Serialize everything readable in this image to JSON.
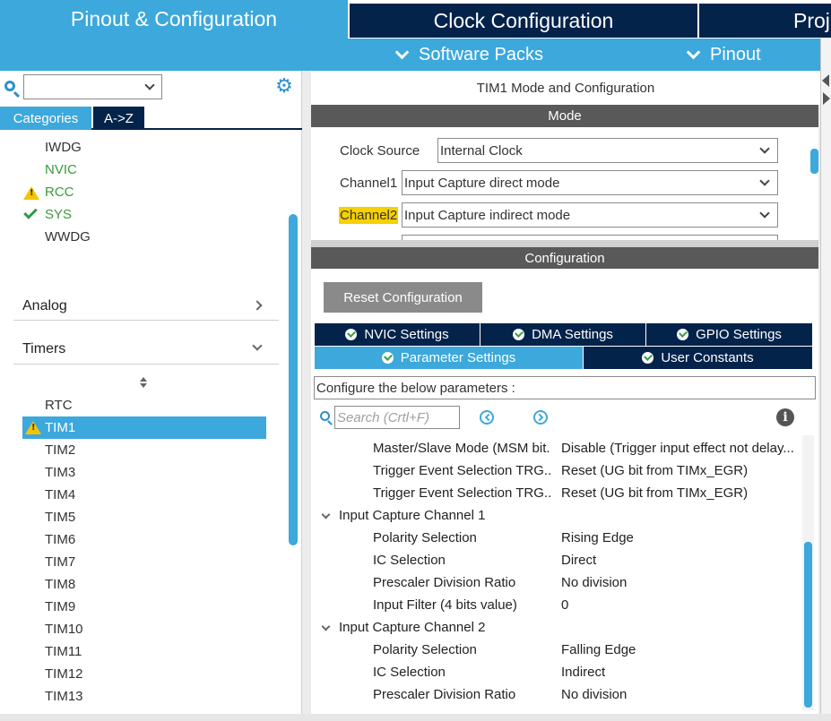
{
  "top_tabs": [
    "Pinout & Configuration",
    "Clock Configuration",
    "Proj"
  ],
  "subbar": {
    "software_packs": "Software Packs",
    "pinout": "Pinout"
  },
  "left": {
    "search_value": "",
    "cat_tabs": [
      "Categories",
      "A->Z"
    ],
    "system_items": [
      {
        "label": "IWDG",
        "status": "none"
      },
      {
        "label": "NVIC",
        "status": "ok"
      },
      {
        "label": "RCC",
        "status": "warning"
      },
      {
        "label": "SYS",
        "status": "check"
      },
      {
        "label": "WWDG",
        "status": "none"
      }
    ],
    "sections": {
      "analog": "Analog",
      "timers": "Timers"
    },
    "timers": [
      "RTC",
      "TIM1",
      "TIM2",
      "TIM3",
      "TIM4",
      "TIM5",
      "TIM6",
      "TIM7",
      "TIM8",
      "TIM9",
      "TIM10",
      "TIM11",
      "TIM12",
      "TIM13"
    ],
    "selected_timer": "TIM1"
  },
  "main": {
    "title": "TIM1 Mode and Configuration",
    "mode_header": "Mode",
    "mode_rows": [
      {
        "label": "Clock Source",
        "value": "Internal Clock"
      },
      {
        "label": "Channel1",
        "value": "Input Capture direct mode"
      },
      {
        "label": "Channel2",
        "value": "Input Capture indirect mode"
      }
    ],
    "config_header": "Configuration",
    "reset_button": "Reset Configuration",
    "tabs_row1": [
      "NVIC Settings",
      "DMA Settings",
      "GPIO Settings"
    ],
    "tabs_row2": [
      "Parameter Settings",
      "User Constants"
    ],
    "description": "Configure the below parameters :",
    "search_placeholder": "Search (Crtl+F)",
    "params": [
      {
        "name": "Master/Slave Mode (MSM bit.",
        "value": "Disable (Trigger input effect not delay..."
      },
      {
        "name": "Trigger Event Selection TRG..",
        "value": "Reset (UG bit from TIMx_EGR)"
      },
      {
        "name": "Trigger Event Selection TRG..",
        "value": "Reset (UG bit from TIMx_EGR)"
      }
    ],
    "group1": {
      "title": "Input Capture Channel 1",
      "params": [
        {
          "name": "Polarity Selection",
          "value": "Rising Edge"
        },
        {
          "name": "IC Selection",
          "value": "Direct"
        },
        {
          "name": "Prescaler Division Ratio",
          "value": "No division"
        },
        {
          "name": "Input Filter (4 bits value)",
          "value": "0"
        }
      ]
    },
    "group2": {
      "title": "Input Capture Channel 2",
      "params": [
        {
          "name": "Polarity Selection",
          "value": "Falling Edge"
        },
        {
          "name": "IC Selection",
          "value": "Indirect"
        },
        {
          "name": "Prescaler Division Ratio",
          "value": "No division"
        }
      ]
    }
  },
  "colors": {
    "accent": "#3ca8dc",
    "navy": "#03234b",
    "header_gray": "#595959",
    "warning": "#f5c400",
    "ok_green": "#3a9a3a",
    "highlight": "#f7d000"
  }
}
